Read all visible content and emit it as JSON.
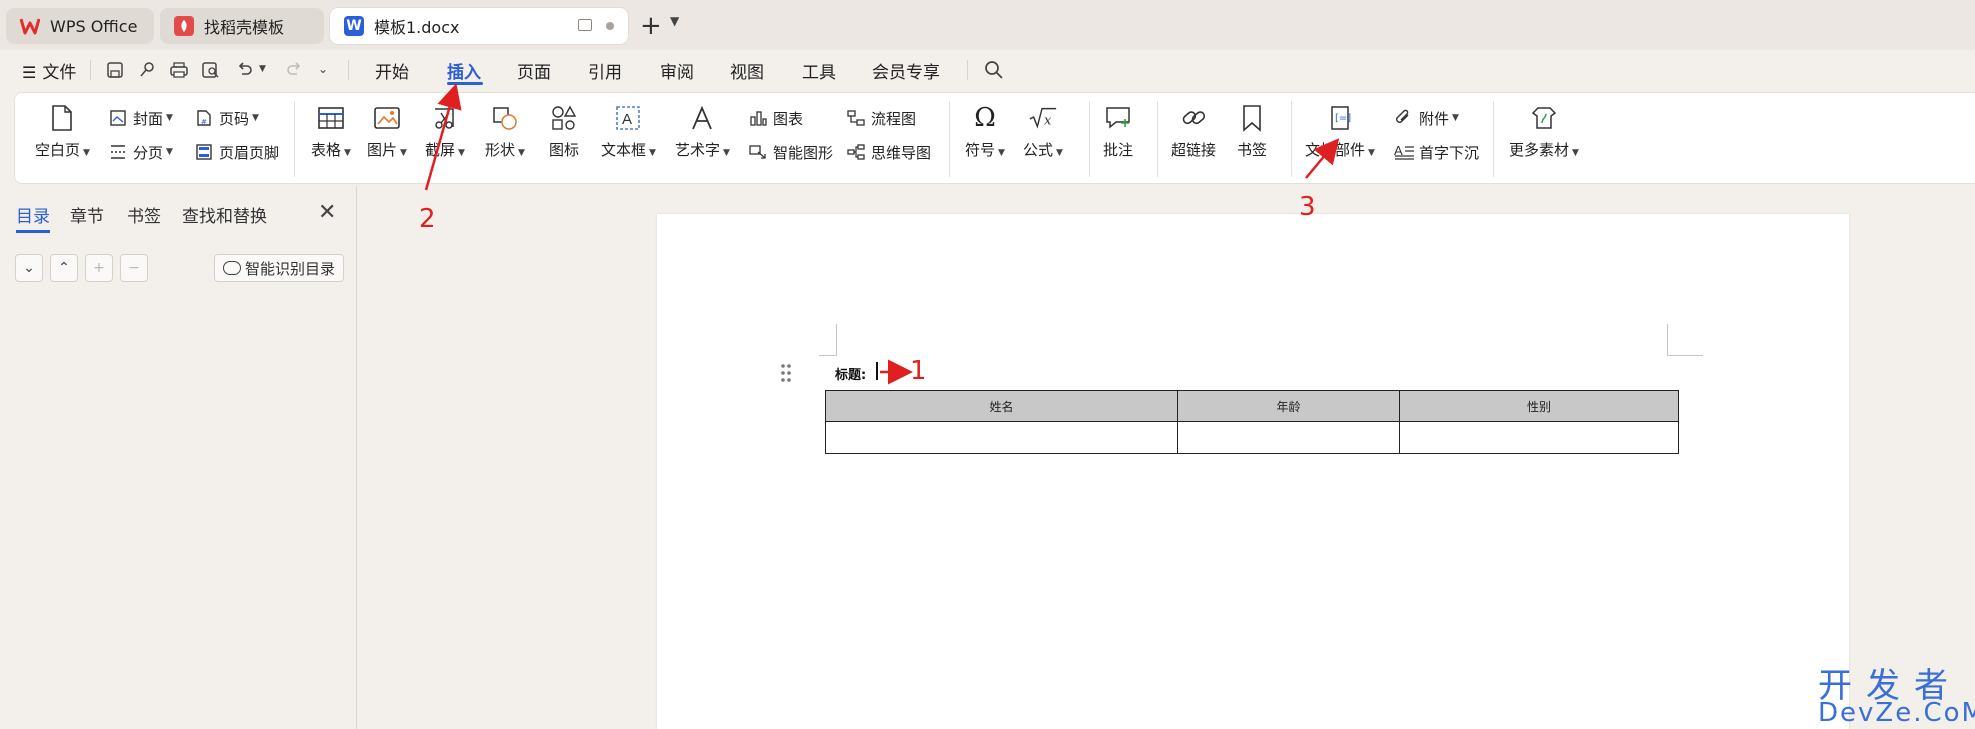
{
  "tabs": [
    {
      "label": "WPS Office",
      "logo": "wps-logo",
      "color": "#e52b2b"
    },
    {
      "label": "找稻壳模板",
      "logo": "docer-logo",
      "color": "#e34a4a"
    },
    {
      "label": "模板1.docx",
      "logo": "word-doc-logo",
      "color": "#2b5fd9"
    }
  ],
  "menu": {
    "file_label": "文件",
    "items": [
      "开始",
      "插入",
      "页面",
      "引用",
      "审阅",
      "视图",
      "工具",
      "会员专享"
    ],
    "active": "插入"
  },
  "ribbon": {
    "blank_page": "空白页",
    "cover": "封面",
    "page_number": "页码",
    "page_break": "分页",
    "header_footer": "页眉页脚",
    "table": "表格",
    "picture": "图片",
    "screenshot": "截屏",
    "shape": "形状",
    "icon": "图标",
    "textbox": "文本框",
    "wordart": "艺术字",
    "chart": "图表",
    "smartart": "智能图形",
    "flowchart": "流程图",
    "mindmap": "思维导图",
    "symbol": "符号",
    "formula": "公式",
    "comment": "批注",
    "hyperlink": "超链接",
    "bookmark": "书签",
    "doc_parts": "文档部件",
    "attachment": "附件",
    "dropcap": "首字下沉",
    "more_materials": "更多素材"
  },
  "left_panel": {
    "tabs": [
      "目录",
      "章节",
      "书签",
      "查找和替换"
    ],
    "active": "目录",
    "smart_toc": "智能识别目录"
  },
  "document": {
    "title_label": "标题:",
    "table_headers": [
      "姓名",
      "年龄",
      "性别"
    ],
    "table_rows": [
      [
        "",
        "",
        ""
      ]
    ]
  },
  "annotations": {
    "one": "1",
    "two": "2",
    "three": "3",
    "color": "#e02020"
  },
  "watermark": {
    "cn": "开发者",
    "en": "DevZe.CoM"
  }
}
